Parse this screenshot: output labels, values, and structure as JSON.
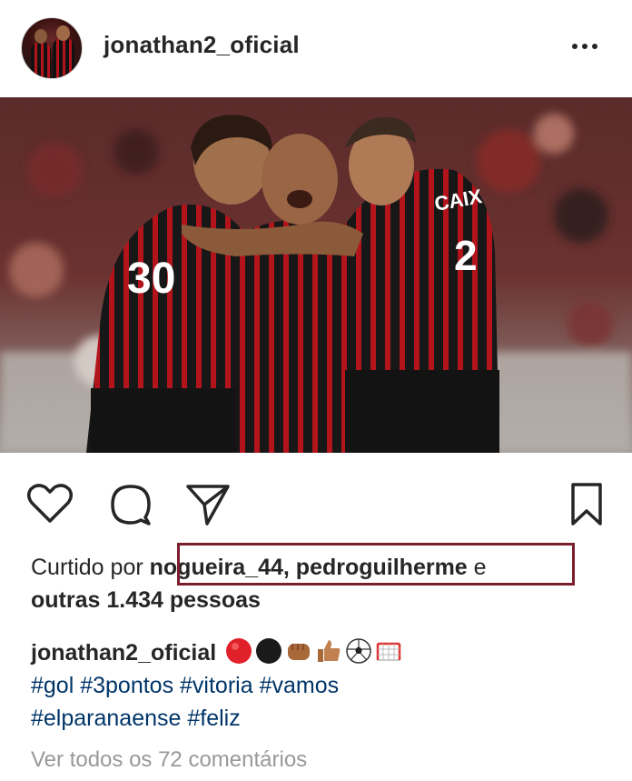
{
  "post": {
    "author": "jonathan2_oficial",
    "likes_prefix": "Curtido por ",
    "likes_users": "nogueira_44, pedroguilherme",
    "likes_suffix": " e",
    "likes_others": "outras 1.434 pessoas",
    "caption_author": "jonathan2_oficial",
    "caption_emojis": [
      "red-circle",
      "black-circle",
      "fist-bump",
      "thumbs-up",
      "soccer-ball",
      "goal-net"
    ],
    "hashtags_line1": "#gol #3pontos #vitoria #vamos",
    "hashtags_line2": "#elparanaense #feliz",
    "view_comments": "Ver todos os 72 comentários",
    "photo_sponsor": "CAIX",
    "jersey_numbers": [
      "30",
      "2"
    ]
  },
  "colors": {
    "text": "#262626",
    "hashtag": "#003569",
    "muted": "#999999",
    "highlight_border": "#7b1e2e",
    "jersey_red": "#b3141c",
    "jersey_black": "#151515"
  },
  "icons": [
    "heart-icon",
    "comment-icon",
    "share-icon",
    "bookmark-icon",
    "more-options-icon"
  ]
}
